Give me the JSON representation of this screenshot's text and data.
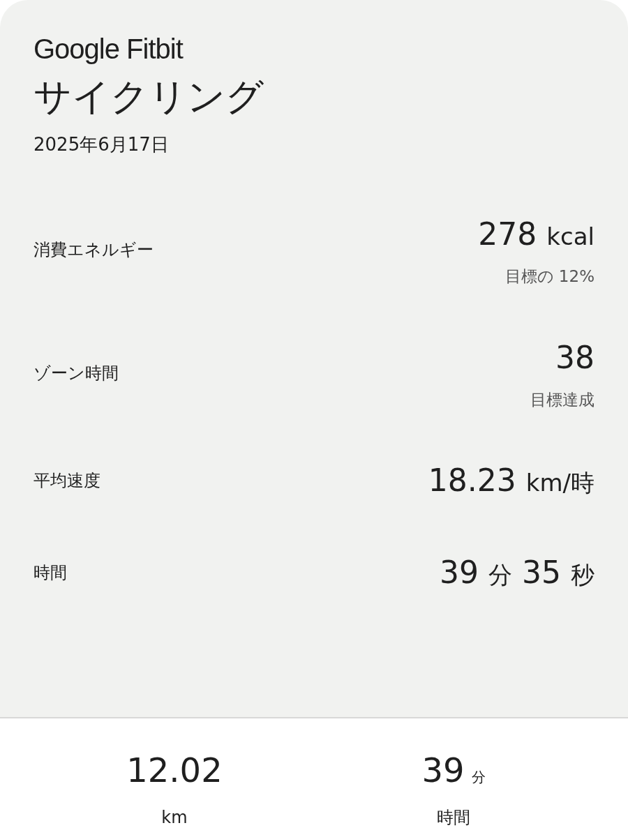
{
  "brand": "Google Fitbit",
  "title": "サイクリング",
  "date": "2025年6月17日",
  "metrics": [
    {
      "label": "消費エネルギー",
      "value": [
        {
          "kind": "number",
          "text": "278"
        },
        {
          "kind": "unit",
          "text": "kcal"
        }
      ],
      "note": "目標の 12%"
    },
    {
      "label": "ゾーン時間",
      "value": [
        {
          "kind": "number",
          "text": "38"
        }
      ],
      "note": "目標達成"
    },
    {
      "label": "平均速度",
      "value": [
        {
          "kind": "number",
          "text": "18.23"
        },
        {
          "kind": "unit",
          "text": "km/時"
        }
      ]
    },
    {
      "label": "時間",
      "value": [
        {
          "kind": "number",
          "text": "39"
        },
        {
          "kind": "unit",
          "text": "分"
        },
        {
          "kind": "number",
          "text": "35"
        },
        {
          "kind": "unit",
          "text": "秒"
        }
      ]
    }
  ],
  "summary": [
    {
      "value": [
        {
          "kind": "number",
          "text": "12.02"
        }
      ],
      "label": "km"
    },
    {
      "value": [
        {
          "kind": "number",
          "text": "39"
        },
        {
          "kind": "unit",
          "text": "分"
        }
      ],
      "label": "時間"
    }
  ]
}
